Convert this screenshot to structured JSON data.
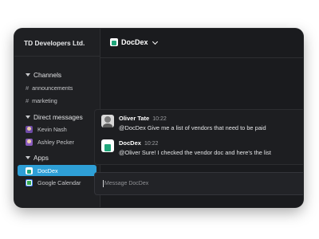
{
  "workspace": {
    "name": "TD Developers Ltd."
  },
  "sidebar": {
    "channels_header": "Channels",
    "channels": [
      {
        "label": "announcements"
      },
      {
        "label": "marketing"
      }
    ],
    "dm_header": "Direct messages",
    "dms": [
      {
        "label": "Kevin Nash"
      },
      {
        "label": "Ashley Pecker"
      }
    ],
    "apps_header": "Apps",
    "apps": [
      {
        "label": "DocDex",
        "active": true
      },
      {
        "label": "Google Calendar",
        "active": false
      }
    ]
  },
  "channel": {
    "title": "DocDex"
  },
  "messages": [
    {
      "author": "Oliver Tate",
      "time": "10:22",
      "text": "@DocDex Give me a list of vendors that need to be paid",
      "avatar_icon": "user-photo"
    },
    {
      "author": "DocDex",
      "time": "10:22",
      "text": "@Oliver Sure! I checked the vendor doc and here's the list",
      "avatar_icon": "docdex-app-icon"
    }
  ],
  "composer": {
    "placeholder": "Message DocDex",
    "value": ""
  },
  "colors": {
    "active_item": "#2e9fd6",
    "app_green": "#1fa67a",
    "window_bg": "#1b1c1f"
  }
}
